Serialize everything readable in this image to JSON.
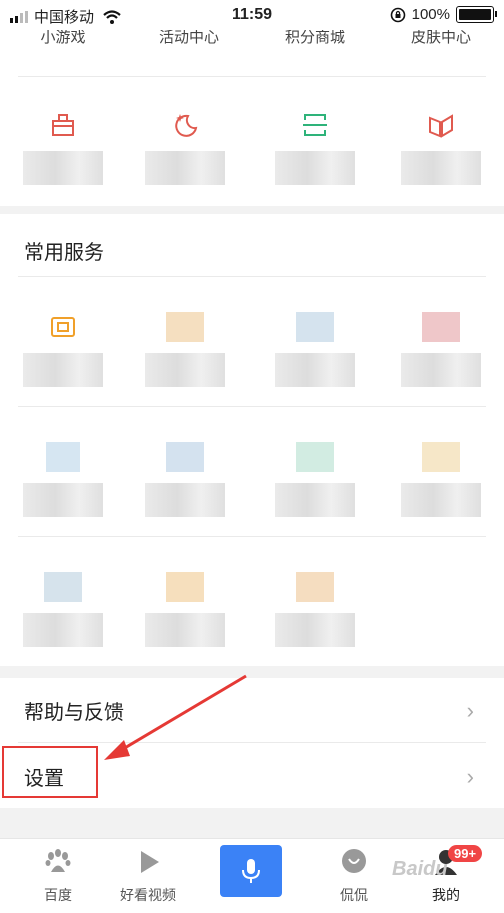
{
  "status_bar": {
    "carrier": "中国移动",
    "time": "11:59",
    "battery": "100%"
  },
  "top_row_labels": [
    "小游戏",
    "活动中心",
    "积分商城",
    "皮肤中心"
  ],
  "section_common": {
    "title": "常用服务"
  },
  "menu": {
    "help_label": "帮助与反馈",
    "settings_label": "设置"
  },
  "tabbar": {
    "tabs": [
      "百度",
      "好看视频",
      "侃侃",
      "我的"
    ],
    "badge": "99+"
  },
  "watermark": "Baidu"
}
